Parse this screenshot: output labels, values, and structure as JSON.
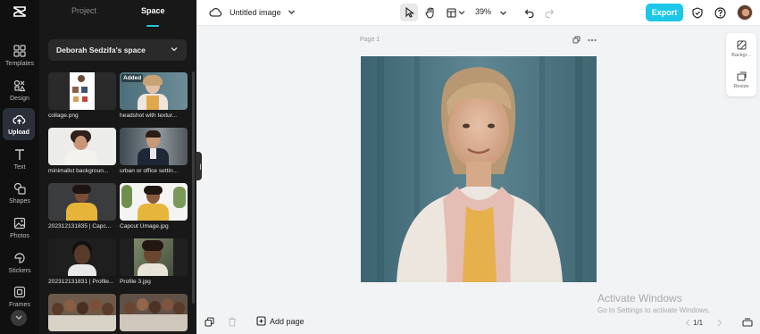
{
  "rail": {
    "items": [
      {
        "label": "Templates",
        "icon": "templates-icon"
      },
      {
        "label": "Design",
        "icon": "design-icon"
      },
      {
        "label": "Upload",
        "icon": "upload-cloud-icon",
        "active": true
      },
      {
        "label": "Text",
        "icon": "text-icon"
      },
      {
        "label": "Shapes",
        "icon": "shapes-icon"
      },
      {
        "label": "Photos",
        "icon": "photos-icon"
      },
      {
        "label": "Stickers",
        "icon": "stickers-icon"
      },
      {
        "label": "Frames",
        "icon": "frames-icon"
      }
    ]
  },
  "panel": {
    "tabs": [
      {
        "label": "Project"
      },
      {
        "label": "Space",
        "active": true
      }
    ],
    "space_name": "Deborah Sedzifa's space",
    "items": [
      {
        "name": "collage.png",
        "badge": ""
      },
      {
        "name": "headshot with textur...",
        "badge": "Added"
      },
      {
        "name": "minimalist backgroun...",
        "badge": ""
      },
      {
        "name": "urban or office settin...",
        "badge": ""
      },
      {
        "name": "202312131835 | Capc...",
        "badge": ""
      },
      {
        "name": "Capcut Umage.jpg",
        "badge": ""
      },
      {
        "name": "202312131831 | Profile...",
        "badge": ""
      },
      {
        "name": "Profile 3.jpg",
        "badge": ""
      },
      {
        "name": "",
        "badge": ""
      },
      {
        "name": "",
        "badge": ""
      }
    ]
  },
  "topbar": {
    "doc_title": "Untitled image",
    "zoom": "39%",
    "export_label": "Export"
  },
  "canvas": {
    "page_label": "Page 1",
    "side_tools": [
      {
        "label": "Backgr..."
      },
      {
        "label": "Resize"
      }
    ]
  },
  "bottom": {
    "add_page_label": "Add page",
    "page_indicator": "1/1"
  },
  "watermark": {
    "line1": "Activate Windows",
    "line2": "Go to Settings to activate Windows."
  },
  "colors": {
    "accent": "#1cc7e7",
    "rail_bg": "#101010",
    "panel_bg": "#181818",
    "canvas_bg": "#f2f3f5"
  }
}
